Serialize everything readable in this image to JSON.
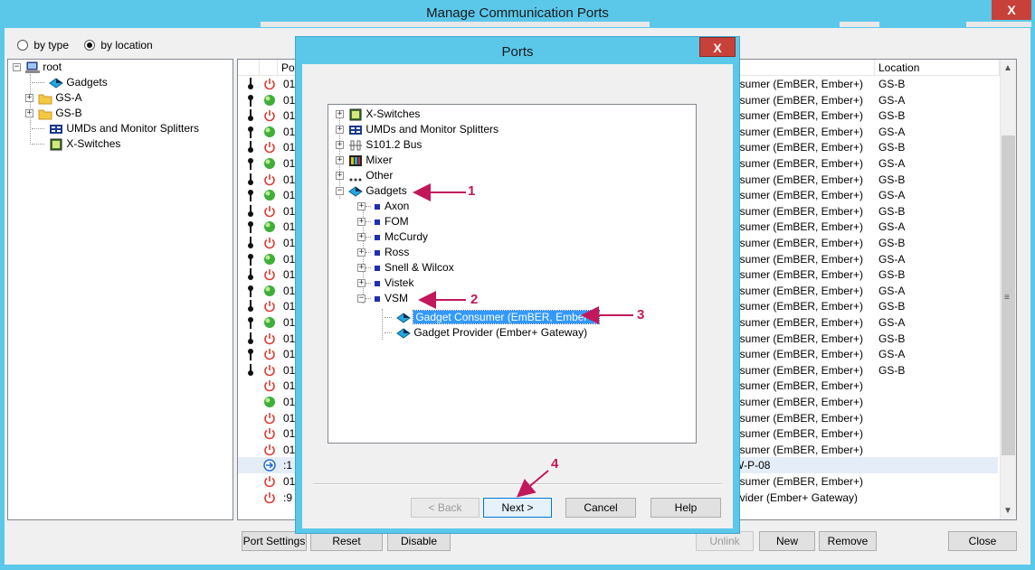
{
  "window": {
    "title": "Manage Communication Ports",
    "close_label": "X"
  },
  "view_options": {
    "by_type_label": "by type",
    "by_location_label": "by location",
    "selected": "by location"
  },
  "location_tree": [
    {
      "label": "root",
      "icon": "computer-icon"
    },
    {
      "label": "Gadgets",
      "icon": "gadget-icon"
    },
    {
      "label": "GS-A",
      "icon": "folder-icon"
    },
    {
      "label": "GS-B",
      "icon": "folder-icon"
    },
    {
      "label": "UMDs and Monitor Splitters",
      "icon": "umd-icon"
    },
    {
      "label": "X-Switches",
      "icon": "xswitch-icon"
    }
  ],
  "port_list": {
    "columns": {
      "port": "Po",
      "location": "Location"
    },
    "rows": [
      {
        "conn": "bottom",
        "status": "off",
        "port": "01",
        "type": "nsumer (EmBER, Ember+)",
        "location": "GS-B"
      },
      {
        "conn": "top",
        "status": "on",
        "port": "01",
        "type": "nsumer (EmBER, Ember+)",
        "location": "GS-A"
      },
      {
        "conn": "bottom",
        "status": "off",
        "port": "01",
        "type": "nsumer (EmBER, Ember+)",
        "location": "GS-B"
      },
      {
        "conn": "top",
        "status": "on",
        "port": "01",
        "type": "nsumer (EmBER, Ember+)",
        "location": "GS-A"
      },
      {
        "conn": "bottom",
        "status": "off",
        "port": "01",
        "type": "nsumer (EmBER, Ember+)",
        "location": "GS-B"
      },
      {
        "conn": "top",
        "status": "on",
        "port": "01",
        "type": "nsumer (EmBER, Ember+)",
        "location": "GS-A"
      },
      {
        "conn": "bottom",
        "status": "off",
        "port": "01",
        "type": "nsumer (EmBER, Ember+)",
        "location": "GS-B"
      },
      {
        "conn": "top",
        "status": "on",
        "port": "01",
        "type": "nsumer (EmBER, Ember+)",
        "location": "GS-A"
      },
      {
        "conn": "bottom",
        "status": "off",
        "port": "01",
        "type": "nsumer (EmBER, Ember+)",
        "location": "GS-B"
      },
      {
        "conn": "top",
        "status": "on",
        "port": "01",
        "type": "nsumer (EmBER, Ember+)",
        "location": "GS-A"
      },
      {
        "conn": "bottom",
        "status": "off",
        "port": "01",
        "type": "nsumer (EmBER, Ember+)",
        "location": "GS-B"
      },
      {
        "conn": "top",
        "status": "on",
        "port": "01",
        "type": "nsumer (EmBER, Ember+)",
        "location": "GS-A"
      },
      {
        "conn": "bottom",
        "status": "off",
        "port": "01",
        "type": "nsumer (EmBER, Ember+)",
        "location": "GS-B"
      },
      {
        "conn": "top",
        "status": "on",
        "port": "01",
        "type": "nsumer (EmBER, Ember+)",
        "location": "GS-A"
      },
      {
        "conn": "bottom",
        "status": "off",
        "port": "01",
        "type": "nsumer (EmBER, Ember+)",
        "location": "GS-B"
      },
      {
        "conn": "top",
        "status": "on",
        "port": "01",
        "type": "nsumer (EmBER, Ember+)",
        "location": "GS-A"
      },
      {
        "conn": "bottom",
        "status": "off",
        "port": "01",
        "type": "nsumer (EmBER, Ember+)",
        "location": "GS-B"
      },
      {
        "conn": "top",
        "status": "off",
        "port": "01",
        "type": "nsumer (EmBER, Ember+)",
        "location": "GS-A"
      },
      {
        "conn": "bottom",
        "status": "off",
        "port": "01",
        "type": "nsumer (EmBER, Ember+)",
        "location": "GS-B"
      },
      {
        "conn": "",
        "status": "off",
        "port": "01",
        "type": "nsumer (EmBER, Ember+)",
        "location": ""
      },
      {
        "conn": "",
        "status": "on",
        "port": "01",
        "type": "nsumer (EmBER, Ember+)",
        "location": ""
      },
      {
        "conn": "",
        "status": "off",
        "port": "01",
        "type": "nsumer (EmBER, Ember+)",
        "location": ""
      },
      {
        "conn": "",
        "status": "off",
        "port": "01",
        "type": "nsumer (EmBER, Ember+)",
        "location": ""
      },
      {
        "conn": "",
        "status": "off",
        "port": "01",
        "type": "nsumer (EmBER, Ember+)",
        "location": ""
      },
      {
        "conn": "",
        "status": "gateway",
        "port": ":1",
        "type": "W-P-08",
        "location": "",
        "selected": true
      },
      {
        "conn": "",
        "status": "off",
        "port": "01",
        "type": "nsumer (EmBER, Ember+)",
        "location": ""
      },
      {
        "conn": "",
        "status": "off",
        "port": ":9",
        "type": "ovider (Ember+ Gateway)",
        "location": ""
      }
    ]
  },
  "main_buttons": {
    "port_settings": "Port Settings",
    "reset": "Reset",
    "disable": "Disable",
    "unlink": "Unlink",
    "new": "New",
    "remove": "Remove",
    "close": "Close"
  },
  "dialog": {
    "title": "Ports",
    "close_label": "X",
    "tree": {
      "top": [
        {
          "label": "X-Switches",
          "icon": "xswitch-icon"
        },
        {
          "label": "UMDs and Monitor Splitters",
          "icon": "umd-icon"
        },
        {
          "label": "S101.2 Bus",
          "icon": "bus-icon"
        },
        {
          "label": "Mixer",
          "icon": "mixer-icon"
        },
        {
          "label": "Other",
          "icon": "other-icon"
        },
        {
          "label": "Gadgets",
          "icon": "gadget-icon"
        }
      ],
      "gadget_children": [
        "Axon",
        "FOM",
        "McCurdy",
        "Ross",
        "Snell & Wilcox",
        "Vistek",
        "VSM"
      ],
      "vsm_children": [
        "Gadget Consumer (EmBER, Ember+)",
        "Gadget Provider (Ember+ Gateway)"
      ]
    },
    "buttons": {
      "back": "< Back",
      "next": "Next >",
      "cancel": "Cancel",
      "help": "Help"
    }
  },
  "annotations": [
    "1",
    "2",
    "3",
    "4"
  ],
  "colors": {
    "annotation": "#c2185b",
    "titlebar": "#5bc8ea",
    "close": "#c7413a",
    "selection": "#3399ff"
  }
}
